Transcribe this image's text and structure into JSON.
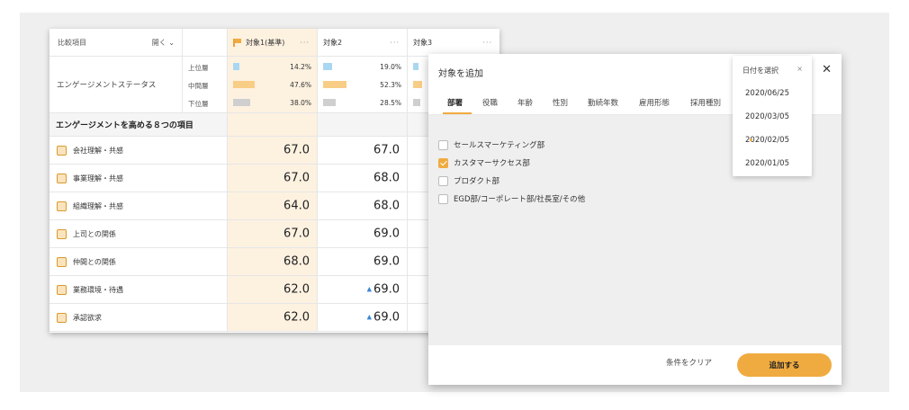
{
  "table": {
    "header": {
      "compare_label": "比較項目",
      "open_label": "開く",
      "targets": [
        {
          "label": "対象1(基準)",
          "menu": "···"
        },
        {
          "label": "対象2",
          "menu": "···"
        },
        {
          "label": "対象3",
          "menu": "···"
        }
      ]
    },
    "engagement": {
      "label": "エンゲージメントステータス",
      "levels": [
        "上位層",
        "中間層",
        "下位層"
      ],
      "target1": [
        "14.2%",
        "47.6%",
        "38.0%"
      ],
      "target2": [
        "19.0%",
        "52.3%",
        "28.5%"
      ],
      "target1_fraction": [
        0.142,
        0.476,
        0.38
      ],
      "target2_fraction": [
        0.19,
        0.523,
        0.285
      ],
      "level_colors": [
        "#a9d7f3",
        "#f8cd86",
        "#cfcfcf"
      ]
    },
    "section_title": "エンゲージメントを高める８つの項目",
    "items": [
      {
        "icon": "building-icon",
        "label": "会社理解・共感",
        "t1": "67.0",
        "t2": "67.0",
        "up": false
      },
      {
        "icon": "presentation-icon",
        "label": "事業理解・共感",
        "t1": "67.0",
        "t2": "68.0",
        "up": false
      },
      {
        "icon": "org-chart-icon",
        "label": "組織理解・共感",
        "t1": "64.0",
        "t2": "68.0",
        "up": false
      },
      {
        "icon": "boss-icon",
        "label": "上司との関係",
        "t1": "67.0",
        "t2": "69.0",
        "up": false
      },
      {
        "icon": "peers-icon",
        "label": "仲間との関係",
        "t1": "68.0",
        "t2": "69.0",
        "up": false
      },
      {
        "icon": "desk-icon",
        "label": "業務環境・待遇",
        "t1": "62.0",
        "t2": "69.0",
        "up": true
      },
      {
        "icon": "handshake-icon",
        "label": "承認欲求",
        "t1": "62.0",
        "t2": "69.0",
        "up": true
      }
    ],
    "up_arrow": "▲"
  },
  "modal": {
    "title": "対象を追加",
    "close": "✕",
    "tabs": [
      "部署",
      "役職",
      "年齢",
      "性別",
      "勤続年数",
      "雇用形態",
      "採用種別"
    ],
    "active_tab": 0,
    "departments": [
      {
        "label": "セールスマーケティング部",
        "checked": false
      },
      {
        "label": "カスタマーサクセス部",
        "checked": true
      },
      {
        "label": "プロダクト部",
        "checked": false
      },
      {
        "label": "EGD部/コーポレート部/社長室/その他",
        "checked": false
      }
    ],
    "clear_label": "条件をクリア",
    "add_label": "追加する",
    "accent": "#f0ab40"
  },
  "date_dropdown": {
    "header": "日付を選択",
    "clear": "×",
    "options": [
      "2020/06/25",
      "2020/03/05",
      "2020/02/05",
      "2020/01/05"
    ],
    "selected": 2
  }
}
